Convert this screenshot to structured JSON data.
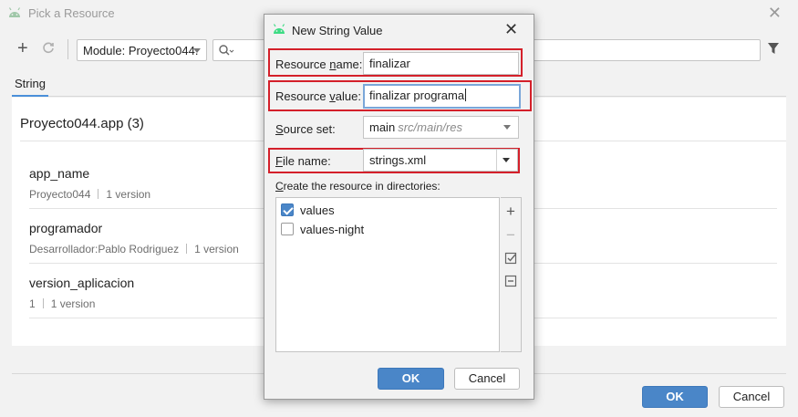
{
  "bg": {
    "title": "Pick a Resource",
    "module_label": "Module: Proyecto044.",
    "tab_label": "String",
    "group_title": "Proyecto044.app (3)",
    "items": [
      {
        "name": "app_name",
        "value": "Proyecto044",
        "versions": "1 version"
      },
      {
        "name": "programador",
        "value": "Desarrollador:Pablo Rodriguez",
        "versions": "1 version"
      },
      {
        "name": "version_aplicacion",
        "value": "1",
        "versions": "1 version"
      }
    ],
    "ok_label": "OK",
    "cancel_label": "Cancel"
  },
  "dialog": {
    "title": "New String Value",
    "resource_name_label_pre": "Resource ",
    "resource_name_label_mn": "n",
    "resource_name_label_post": "ame:",
    "resource_name_value": "finalizar",
    "resource_value_label_pre": "Resource ",
    "resource_value_label_mn": "v",
    "resource_value_label_post": "alue:",
    "resource_value_value": "finalizar programa",
    "source_set_label_mn": "S",
    "source_set_label_post": "ource set:",
    "source_set_value": "main",
    "source_set_path": "src/main/res",
    "file_name_label_mn": "F",
    "file_name_label_post": "ile name:",
    "file_name_value": "strings.xml",
    "dirs_label_mn": "C",
    "dirs_label_post": "reate the resource in directories:",
    "directories": [
      {
        "name": "values",
        "checked": true
      },
      {
        "name": "values-night",
        "checked": false
      }
    ],
    "ok_label": "OK",
    "cancel_label": "Cancel"
  },
  "colors": {
    "accent": "#4a86c8",
    "highlight": "#d4202a",
    "android_green": "#3ddc84"
  }
}
